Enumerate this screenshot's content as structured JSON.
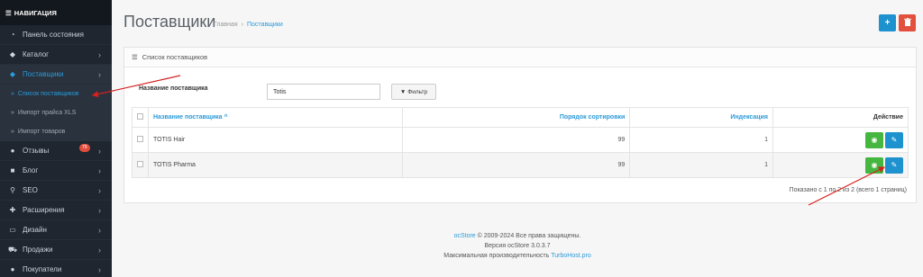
{
  "sidebar": {
    "header": "НАВИГАЦИЯ",
    "items": [
      {
        "label": "Панель состояния",
        "icon": "dashboard-icon",
        "glyph": "◔"
      },
      {
        "label": "Каталог",
        "icon": "tag-icon",
        "glyph": "◆",
        "chevron": "›"
      },
      {
        "label": "Поставщики",
        "icon": "tag-icon",
        "glyph": "◆",
        "chevron": "›"
      }
    ],
    "subitems": [
      {
        "label": "Список поставщиков",
        "marker": "»"
      },
      {
        "label": "Импорт прайса XLS",
        "marker": "»"
      },
      {
        "label": "Импорт товаров",
        "marker": "»"
      }
    ],
    "items2": [
      {
        "label": "Отзывы",
        "icon": "user-icon",
        "glyph": "●",
        "chevron": "›",
        "badge": "79"
      },
      {
        "label": "Блог",
        "icon": "blog-icon",
        "glyph": "■",
        "chevron": "›"
      },
      {
        "label": "SEO",
        "icon": "search-icon",
        "glyph": "⚲",
        "chevron": "›"
      },
      {
        "label": "Расширения",
        "icon": "puzzle-icon",
        "glyph": "✚",
        "chevron": "›"
      },
      {
        "label": "Дизайн",
        "icon": "monitor-icon",
        "glyph": "▭",
        "chevron": "›"
      },
      {
        "label": "Продажи",
        "icon": "cart-icon",
        "glyph": "⛟",
        "chevron": "›"
      },
      {
        "label": "Покупатели",
        "icon": "user-icon",
        "glyph": "●",
        "chevron": "›"
      }
    ]
  },
  "header": {
    "title": "Поставщики",
    "breadcrumb": [
      "Главная",
      "›",
      "Поставщики"
    ],
    "add_icon": "+",
    "delete_icon": "🗑"
  },
  "panel": {
    "title": "Список поставщиков",
    "filter_label": "Название поставщика",
    "filter_value": "Totis",
    "filter_button": "Фильтр",
    "columns": [
      "Название поставщика ^",
      "Порядок сортировки",
      "Индексация",
      "Действие"
    ],
    "rows": [
      {
        "name": "TOTIS Hair",
        "sort": "99",
        "index": "1"
      },
      {
        "name": "TOTIS Pharma",
        "sort": "99",
        "index": "1"
      }
    ],
    "pagination": "Показано с 1 по 2 из 2 (всего 1 страниц)"
  },
  "footer": {
    "brand": "ocStore",
    "copyright": "© 2009-2024 Все права защищены.",
    "version": "Версия ocStore 3.0.3.7",
    "hosting_text": "Максимальная производительность",
    "hosting_link": "TurboHost.pro"
  },
  "colors": {
    "accent": "#2b9ad8",
    "sidebar": "#1f2630",
    "success": "#45b63f",
    "danger": "#e3503e",
    "annotation": "#d62020"
  }
}
